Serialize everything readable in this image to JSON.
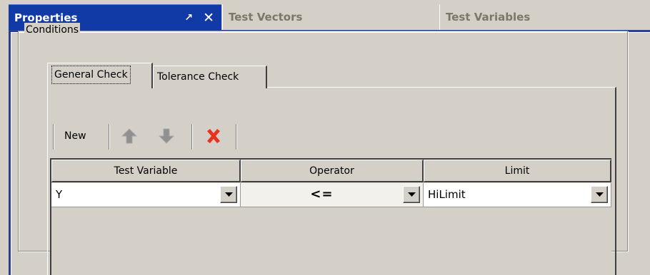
{
  "tabs": [
    {
      "label": "Properties",
      "active": true
    },
    {
      "label": "Test Vectors",
      "active": false
    },
    {
      "label": "Test Variables",
      "active": false
    }
  ],
  "tab_buttons": {
    "pin_icon": "pin-icon",
    "close_label": "✕"
  },
  "conditions": {
    "title": "Conditions",
    "subtabs": [
      {
        "label": "General Check",
        "selected": true
      },
      {
        "label": "Tolerance Check",
        "selected": false
      }
    ],
    "toolbar": {
      "new_label": "New",
      "icons": [
        "arrow-up-icon",
        "arrow-down-icon",
        "delete-icon"
      ]
    },
    "grid": {
      "columns": [
        "Test Variable",
        "Operator",
        "Limit"
      ],
      "rows": [
        {
          "test_variable": "Y",
          "operator": "<=",
          "limit": "HiLimit"
        }
      ]
    }
  },
  "colors": {
    "active_tab": "#123aa6",
    "inactive_tab_text": "#7a7868",
    "panel_bg": "#d4d0c8",
    "delete_red": "#e8321e",
    "arrow_gray": "#909090"
  }
}
